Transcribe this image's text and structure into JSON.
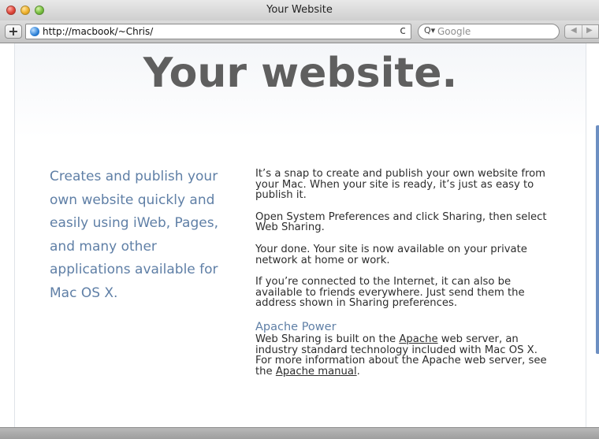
{
  "window": {
    "title": "Your Website"
  },
  "toolbar": {
    "add_button_label": "+",
    "url": "http://macbook/~Chris/",
    "reload_glyph": "c",
    "search_icon_glyph": "Q▾",
    "search_placeholder": "Google",
    "back_glyph": "◀",
    "forward_glyph": "▶"
  },
  "page": {
    "hero_title": "Your website.",
    "tagline": "Creates and publish your own website quickly and easily using iWeb, Pages, and many other applications available for Mac OS X.",
    "paragraphs": [
      "It’s a snap to create and publish your own website from your Mac. When your site is ready, it’s just as easy to publish it.",
      "Open System Preferences and click Sharing, then select Web Sharing.",
      "Your done. Your site is now available on your private network at home or work.",
      "If you’re connected to the Internet, it can also be available to friends everywhere. Just send them the address shown in Sharing preferences."
    ],
    "apache": {
      "heading": "Apache Power",
      "text_1": "Web Sharing is built on the ",
      "link_1": "Apache",
      "text_2": " web server, an industry standard technology included with Mac OS X. For more information about the Apache web server, see the ",
      "link_2": "Apache manual",
      "text_3": "."
    }
  }
}
